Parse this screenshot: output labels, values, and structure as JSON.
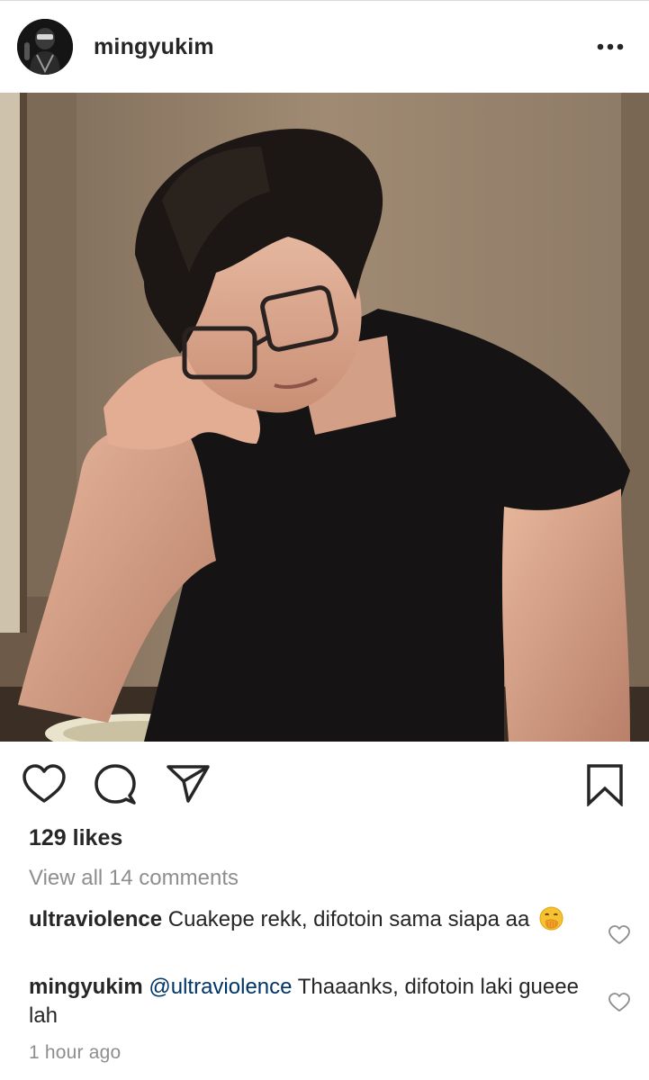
{
  "post": {
    "username": "mingyukim",
    "more_icon": "more-dots-icon",
    "likes": "129 likes",
    "view_all_comments": "View all 14 comments",
    "time_ago": "1 hour ago"
  },
  "actions": {
    "like_icon": "heart-icon",
    "comment_icon": "comment-bubble-icon",
    "share_icon": "paper-plane-icon",
    "save_icon": "bookmark-icon"
  },
  "comments": [
    {
      "username": "ultraviolence",
      "text": "Cuakepe rekk, difotoin sama siapa aa",
      "emoji": "face-with-hand-over-mouth-emoji"
    },
    {
      "username": "mingyukim",
      "mention": "@ultraviolence",
      "text": "Thaaanks, difotoin laki gueee lah"
    }
  ],
  "colors": {
    "text": "#262626",
    "secondary_text": "#8e8e8e",
    "mention": "#003569",
    "divider": "#d9d9d9"
  }
}
